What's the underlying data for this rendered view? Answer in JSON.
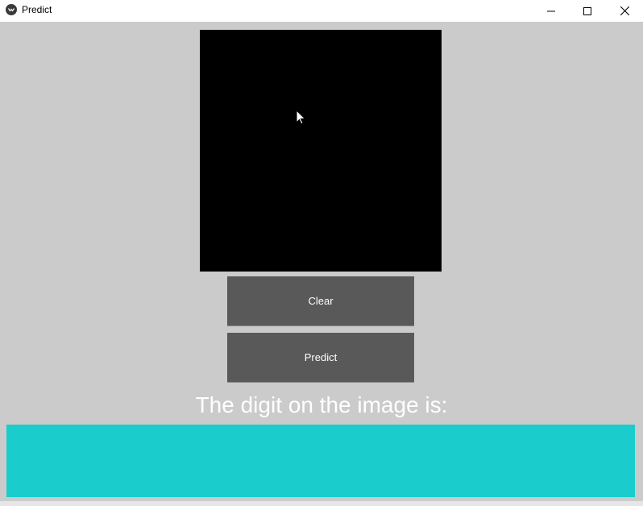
{
  "window": {
    "title": "Predict",
    "icon": "kivy-app-icon",
    "controls": [
      "minimize-icon",
      "maximize-icon",
      "close-icon"
    ]
  },
  "canvas": {
    "background": "#000000"
  },
  "buttons": {
    "clear_label": "Clear",
    "predict_label": "Predict",
    "color": "#595959"
  },
  "result": {
    "label": "The digit on the image is:",
    "value": "",
    "box_color": "#1acccc"
  },
  "colors": {
    "background": "#cbcbcb",
    "text": "#ffffff"
  }
}
